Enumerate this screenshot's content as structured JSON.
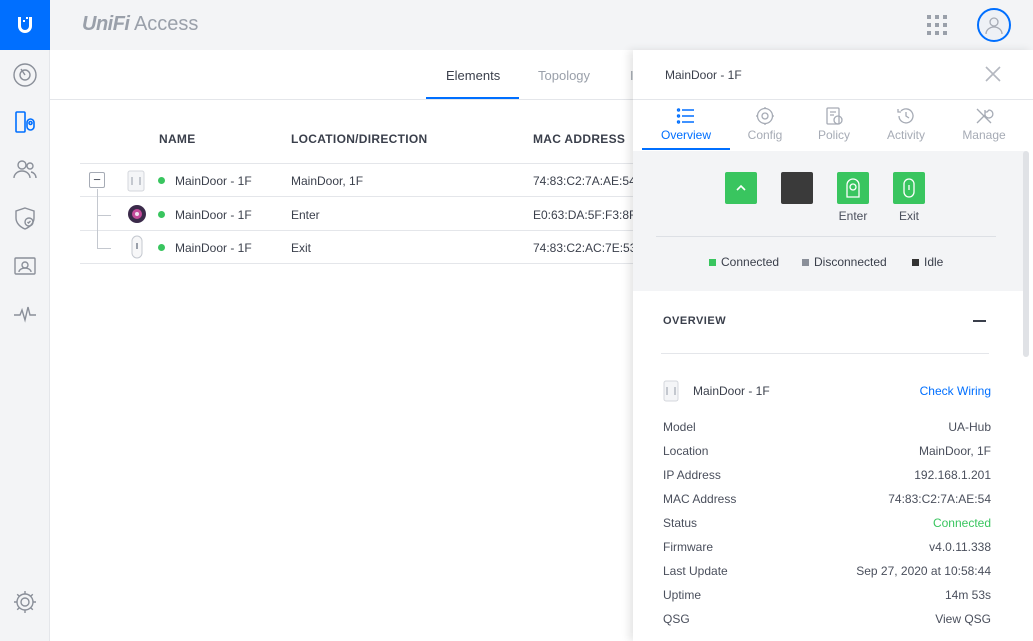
{
  "app": {
    "brand_unifi": "UniFi",
    "brand_access": "Access"
  },
  "nav": {
    "icons": [
      "dashboard-icon",
      "doors-icon",
      "users-icon",
      "policies-icon",
      "cards-icon",
      "activity-icon",
      "settings-icon"
    ]
  },
  "tabs": [
    {
      "label": "Elements",
      "active": true
    },
    {
      "label": "Topology",
      "active": false
    },
    {
      "label": "I",
      "active": false
    }
  ],
  "table": {
    "headers": {
      "name": "NAME",
      "location": "LOCATION/DIRECTION",
      "mac": "MAC ADDRESS"
    },
    "rows": [
      {
        "name": "MainDoor - 1F",
        "location": "MainDoor, 1F",
        "mac": "74:83:C2:7A:AE:54",
        "status": "connected"
      },
      {
        "name": "MainDoor - 1F",
        "location": "Enter",
        "mac": "E0:63:DA:5F:F3:8F",
        "status": "connected"
      },
      {
        "name": "MainDoor - 1F",
        "location": "Exit",
        "mac": "74:83:C2:AC:7E:53",
        "status": "connected"
      }
    ]
  },
  "panel": {
    "title": "MainDoor - 1F",
    "tabs": [
      {
        "label": "Overview",
        "icon": "list-icon",
        "active": true
      },
      {
        "label": "Config",
        "icon": "gear-icon",
        "active": false
      },
      {
        "label": "Policy",
        "icon": "policy-icon",
        "active": false
      },
      {
        "label": "Activity",
        "icon": "history-icon",
        "active": false
      },
      {
        "label": "Manage",
        "icon": "tools-icon",
        "active": false
      }
    ],
    "status_buttons": [
      {
        "icon": "chevron-up-icon",
        "label": "",
        "color": "#39c55f"
      },
      {
        "icon": "",
        "label": "",
        "color": "#3a3a3a"
      },
      {
        "icon": "reader-icon",
        "label": "Enter",
        "color": "#39c55f"
      },
      {
        "icon": "exit-button-icon",
        "label": "Exit",
        "color": "#39c55f"
      }
    ],
    "legend": [
      {
        "label": "Connected",
        "color": "#39c55f"
      },
      {
        "label": "Disconnected",
        "color": "#8a8f99"
      },
      {
        "label": "Idle",
        "color": "#333333"
      }
    ],
    "overview": {
      "heading": "OVERVIEW",
      "device_name": "MainDoor - 1F",
      "check_wiring": "Check Wiring",
      "fields": [
        {
          "key": "Model",
          "value": "UA-Hub"
        },
        {
          "key": "Location",
          "value": "MainDoor, 1F"
        },
        {
          "key": "IP Address",
          "value": "192.168.1.201"
        },
        {
          "key": "MAC Address",
          "value": "74:83:C2:7A:AE:54"
        },
        {
          "key": "Status",
          "value": "Connected"
        },
        {
          "key": "Firmware",
          "value": "v4.0.11.338"
        },
        {
          "key": "Last Update",
          "value": "Sep 27, 2020 at 10:58:44"
        },
        {
          "key": "Uptime",
          "value": "14m 53s"
        },
        {
          "key": "QSG",
          "value": "View QSG"
        }
      ]
    }
  },
  "colors": {
    "accent": "#006fff",
    "connected": "#39c55f"
  }
}
